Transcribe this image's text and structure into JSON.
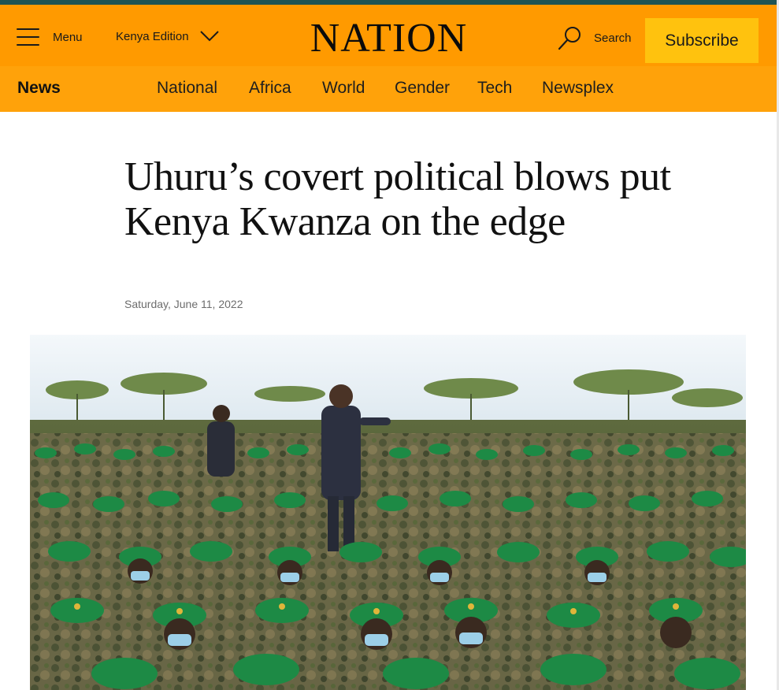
{
  "header": {
    "menu_label": "Menu",
    "edition_label": "Kenya Edition",
    "logo_text": "NATION",
    "search_label": "Search",
    "subscribe_label": "Subscribe",
    "colors": {
      "brand_orange": "#ff9a00",
      "subscribe_yellow": "#ffc20e",
      "top_strip": "#1e5454"
    },
    "icons": [
      "hamburger-icon",
      "chevron-down-icon",
      "search-icon"
    ]
  },
  "subnav": {
    "section": "News",
    "links": [
      "National",
      "Africa",
      "World",
      "Gender",
      "Tech",
      "Newsplex"
    ]
  },
  "article": {
    "headline": "Uhuru’s covert political blows put Kenya Kwanza on the edge",
    "date": "Saturday, June 11, 2022"
  }
}
